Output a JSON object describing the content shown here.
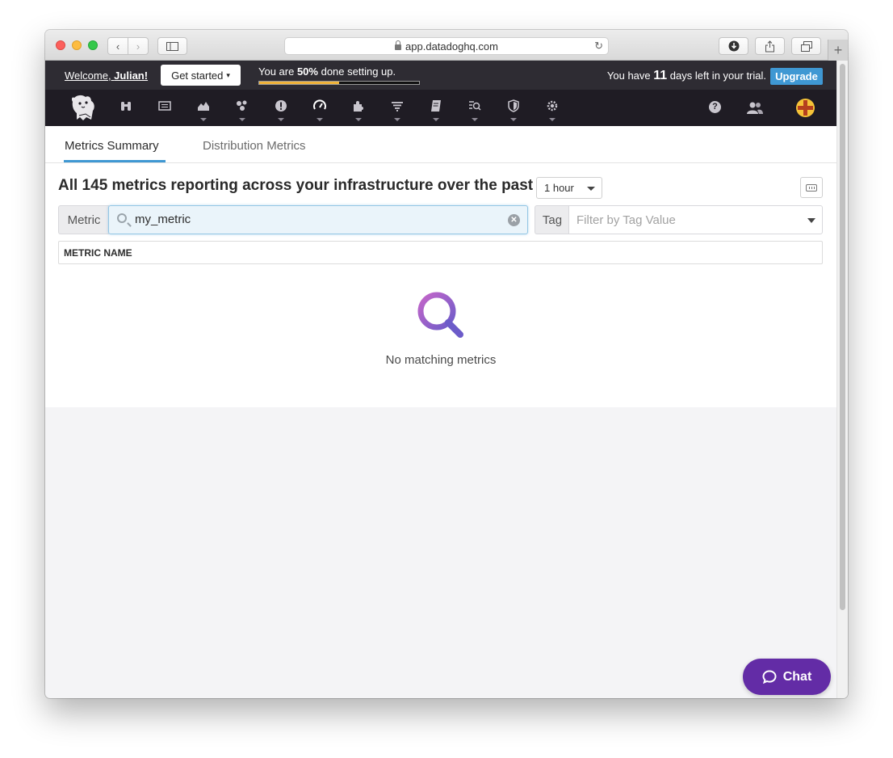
{
  "browser": {
    "url": "app.datadoghq.com"
  },
  "trial_bar": {
    "welcome_prefix": "Welcome, ",
    "welcome_name": "Julian!",
    "get_started_label": "Get started",
    "setup_prefix": "You are ",
    "setup_percent_text": "50%",
    "setup_suffix": " done setting up.",
    "setup_progress": 0.5,
    "trial_prefix": "You have ",
    "trial_days": "11",
    "trial_suffix": " days left in your trial.",
    "upgrade_label": "Upgrade"
  },
  "nav": {
    "icons": [
      "binoculars-icon",
      "list-icon",
      "area-chart-icon",
      "hexagons-icon",
      "alert-icon",
      "gauge-icon",
      "puzzle-icon",
      "filter-list-icon",
      "notebook-icon",
      "log-search-icon",
      "shield-icon",
      "gear-icon"
    ],
    "help_icon": "question-icon",
    "team_icon": "team-icon"
  },
  "tabs": [
    {
      "label": "Metrics Summary",
      "active": true
    },
    {
      "label": "Distribution Metrics",
      "active": false
    }
  ],
  "summary": {
    "heading": "All 145 metrics reporting across your infrastructure over the past",
    "time_range": "1 hour"
  },
  "filters": {
    "metric_label": "Metric",
    "metric_value": "my_metric",
    "tag_label": "Tag",
    "tag_placeholder": "Filter by Tag Value"
  },
  "table": {
    "column_header": "METRIC NAME",
    "empty_message": "No matching metrics"
  },
  "chat": {
    "label": "Chat"
  },
  "colors": {
    "accent_blue": "#3f98d3",
    "progress_yellow": "#f1b43a",
    "chat_purple": "#632ca6",
    "nav_bg": "#1f1c24"
  }
}
